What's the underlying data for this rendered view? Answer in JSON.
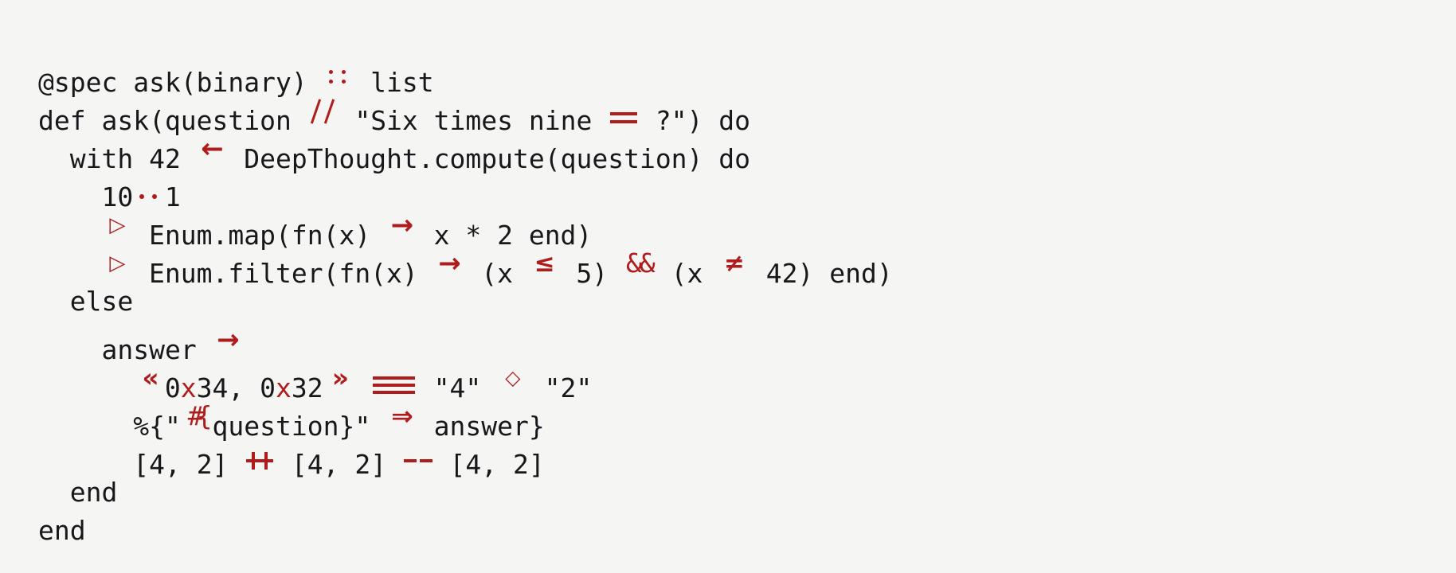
{
  "view": {
    "kind": "code-sample",
    "language": "elixir",
    "background_color": "#f5f5f4",
    "text_color": "#17181a",
    "operator_color": "#b01b1b",
    "font_size_px": 33,
    "line_height_px": 48
  },
  "code": {
    "raw": "@spec ask(binary) :: list\ndef ask(question \\\\ \"Six times nine == ?\") do\n  with 42 <- DeepThought.compute(question) do\n    10..1\n    |> Enum.map(fn(x) -> x * 2 end)\n    |> Enum.filter(fn(x) -> (x <= 5) && (x != 42) end)\n  else\n    answer ->\n      <<0x34, 0x32>> === \"4\" <> \"2\"\n      %{\"#{question}\" => answer}\n      [4, 2] ++ [4, 2] -- [4, 2]\n  end\nend",
    "lines": [
      {
        "n": 1,
        "indent": "",
        "tokens": [
          {
            "t": "@spec ask(binary) ",
            "k": "plain"
          },
          {
            "t": "::",
            "k": "lig",
            "lig": "colcol",
            "cells": 2
          },
          {
            "t": " list",
            "k": "plain"
          }
        ]
      },
      {
        "n": 2,
        "indent": "",
        "tokens": [
          {
            "t": "def ask(question ",
            "k": "plain"
          },
          {
            "t": "\\\\",
            "k": "lig",
            "lig": "bsbs",
            "cells": 2
          },
          {
            "t": " \"Six times nine ",
            "k": "plain"
          },
          {
            "t": "==",
            "k": "lig",
            "lig": "eqeq",
            "cells": 2
          },
          {
            "t": " ?\") do",
            "k": "plain"
          }
        ]
      },
      {
        "n": 3,
        "indent": "  ",
        "tokens": [
          {
            "t": "with 42 ",
            "k": "plain"
          },
          {
            "t": "<-",
            "k": "lig",
            "lig": "larrow",
            "cells": 2
          },
          {
            "t": " DeepThought.compute(question) do",
            "k": "plain"
          }
        ]
      },
      {
        "n": 4,
        "indent": "    ",
        "tokens": [
          {
            "t": "10",
            "k": "plain"
          },
          {
            "t": "..",
            "k": "lig",
            "lig": "dotdot",
            "cells": 2
          },
          {
            "t": "1",
            "k": "plain"
          }
        ]
      },
      {
        "n": 5,
        "indent": "    ",
        "tokens": [
          {
            "t": "|>",
            "k": "lig",
            "lig": "pipe",
            "cells": 2
          },
          {
            "t": " Enum.map(fn(x) ",
            "k": "plain"
          },
          {
            "t": "->",
            "k": "lig",
            "lig": "rarrow",
            "cells": 2
          },
          {
            "t": " x * 2 end)",
            "k": "plain"
          }
        ]
      },
      {
        "n": 6,
        "indent": "    ",
        "tokens": [
          {
            "t": "|>",
            "k": "lig",
            "lig": "pipe",
            "cells": 2
          },
          {
            "t": " Enum.filter(fn(x) ",
            "k": "plain"
          },
          {
            "t": "->",
            "k": "lig",
            "lig": "rarrow",
            "cells": 2
          },
          {
            "t": " (x ",
            "k": "plain"
          },
          {
            "t": "<=",
            "k": "lig",
            "lig": "le",
            "cells": 2
          },
          {
            "t": " 5) ",
            "k": "plain"
          },
          {
            "t": "&&",
            "k": "lig",
            "lig": "ampamp",
            "cells": 2
          },
          {
            "t": " (x ",
            "k": "plain"
          },
          {
            "t": "!=",
            "k": "lig",
            "lig": "ne",
            "cells": 2
          },
          {
            "t": " 42) end)",
            "k": "plain"
          }
        ]
      },
      {
        "n": 7,
        "indent": "  ",
        "tokens": [
          {
            "t": "else",
            "k": "plain"
          }
        ]
      },
      {
        "n": 8,
        "indent": "    ",
        "tokens": [
          {
            "t": "answer ",
            "k": "plain"
          },
          {
            "t": "->",
            "k": "lig",
            "lig": "rarrow",
            "cells": 2
          }
        ]
      },
      {
        "n": 9,
        "indent": "      ",
        "tokens": [
          {
            "t": "<<",
            "k": "lig",
            "lig": "ltlt",
            "cells": 2
          },
          {
            "t": "0",
            "k": "plain"
          },
          {
            "t": "x",
            "k": "op"
          },
          {
            "t": "34, 0",
            "k": "plain"
          },
          {
            "t": "x",
            "k": "op"
          },
          {
            "t": "32",
            "k": "plain"
          },
          {
            "t": ">>",
            "k": "lig",
            "lig": "gtgt",
            "cells": 2
          },
          {
            "t": " ",
            "k": "plain"
          },
          {
            "t": "===",
            "k": "lig",
            "lig": "eqeqeq",
            "cells": 3
          },
          {
            "t": " \"4\" ",
            "k": "plain"
          },
          {
            "t": "<>",
            "k": "lig",
            "lig": "diamond",
            "cells": 2
          },
          {
            "t": " \"2\"",
            "k": "plain"
          }
        ]
      },
      {
        "n": 10,
        "indent": "      ",
        "tokens": [
          {
            "t": "%{\"",
            "k": "plain"
          },
          {
            "t": "#{",
            "k": "lig",
            "lig": "interp",
            "cells": 2
          },
          {
            "t": "question}\" ",
            "k": "plain"
          },
          {
            "t": "=>",
            "k": "lig",
            "lig": "darrow",
            "cells": 2
          },
          {
            "t": " answer}",
            "k": "plain"
          }
        ]
      },
      {
        "n": 11,
        "indent": "      ",
        "tokens": [
          {
            "t": "[4, 2] ",
            "k": "plain"
          },
          {
            "t": "++",
            "k": "lig",
            "lig": "plusplus",
            "cells": 2
          },
          {
            "t": " [4, 2] ",
            "k": "plain"
          },
          {
            "t": "--",
            "k": "lig",
            "lig": "dashdash",
            "cells": 2
          },
          {
            "t": " [4, 2]",
            "k": "plain"
          }
        ]
      },
      {
        "n": 12,
        "indent": "  ",
        "tokens": [
          {
            "t": "end",
            "k": "plain"
          }
        ]
      },
      {
        "n": 13,
        "indent": "",
        "tokens": [
          {
            "t": "end",
            "k": "plain"
          }
        ]
      }
    ]
  },
  "ligature_glyphs": {
    "larrow": "←",
    "rarrow": "→",
    "darrow": "⇒",
    "le": "≤",
    "ne": "≠",
    "pipe": "▷",
    "diamond": "◇",
    "ltlt": "«",
    "gtgt": "»",
    "ampamp": "&&",
    "interp": "#{"
  }
}
